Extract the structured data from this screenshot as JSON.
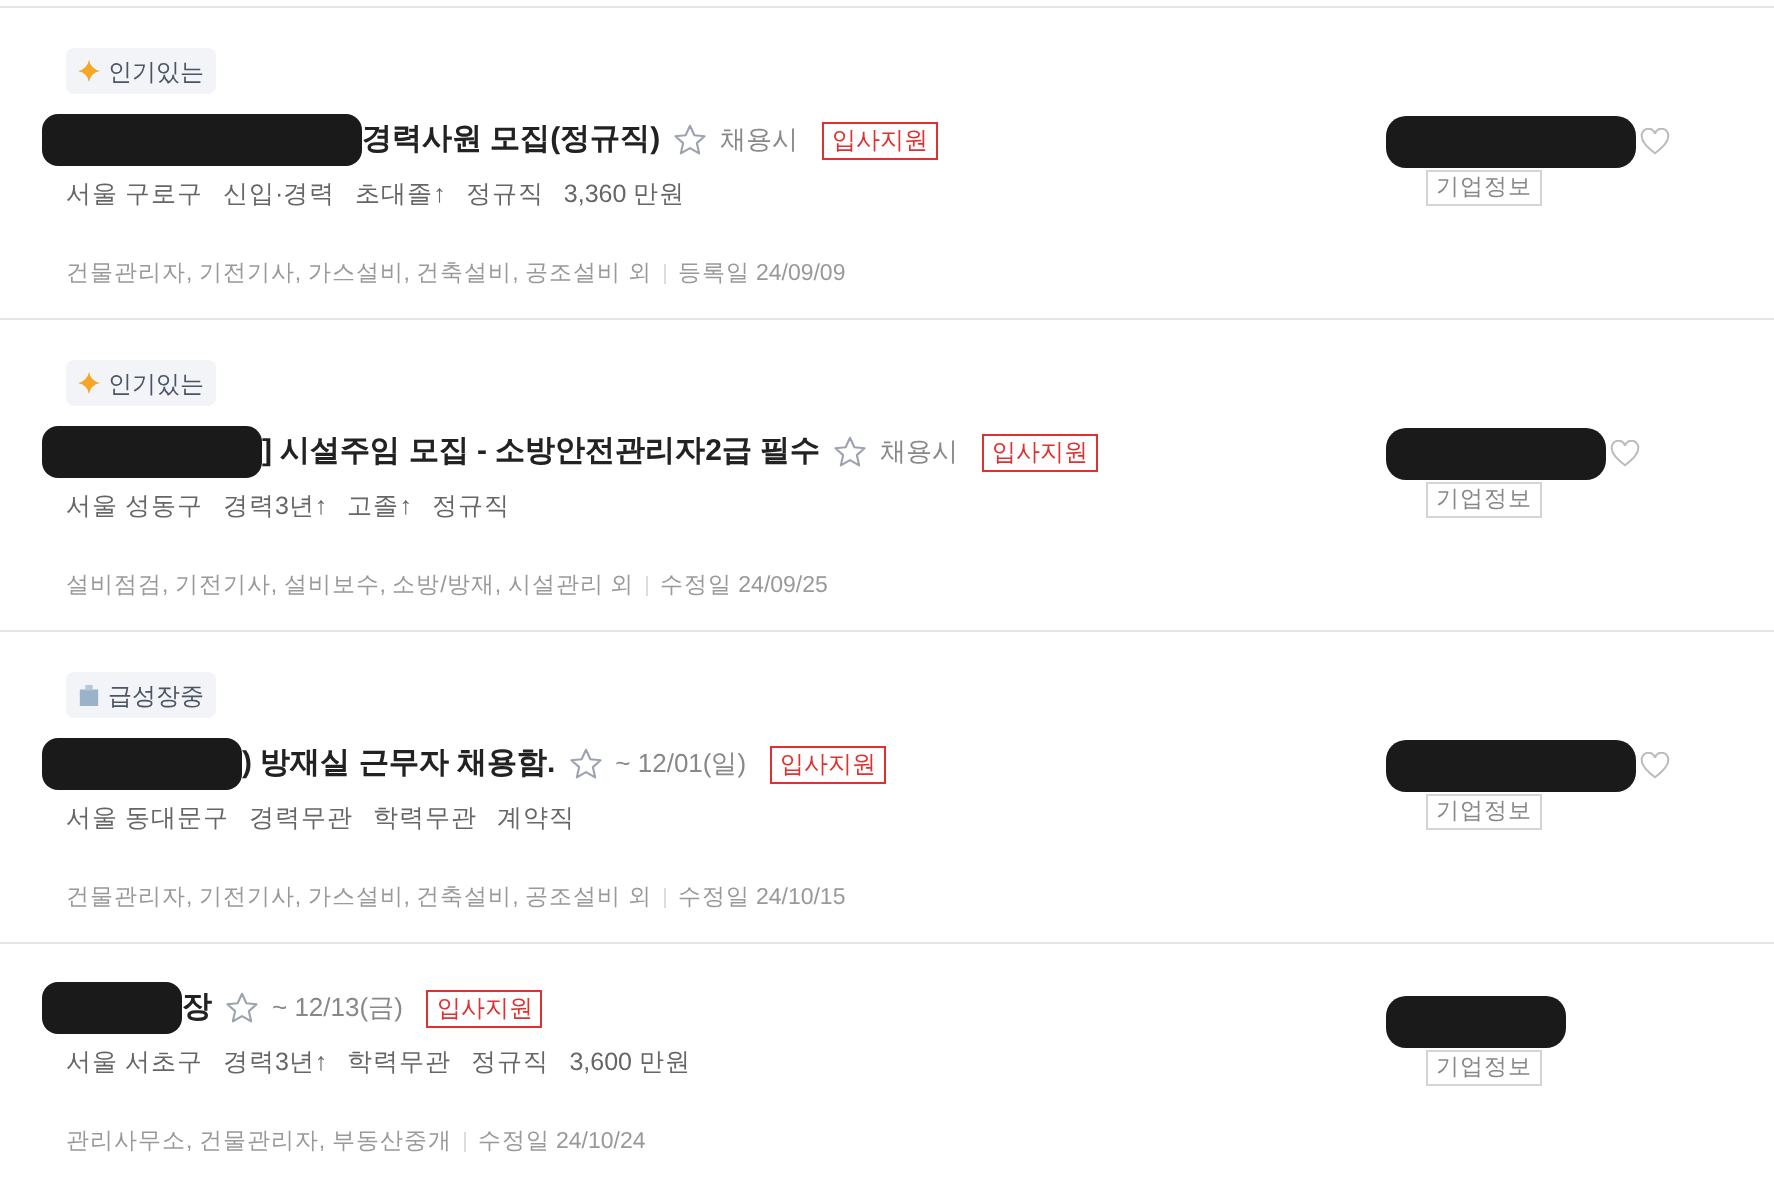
{
  "listings": [
    {
      "badge": {
        "kind": "popular",
        "label": "인기있는"
      },
      "title": "경력사원 모집(정규직)",
      "scrapped": false,
      "deadline": "채용시",
      "apply": "입사지원",
      "meta": [
        "서울 구로구",
        "신입·경력",
        "초대졸↑",
        "정규직",
        "3,360 만원"
      ],
      "jobs": "건물관리자, 기전기사, 가스설비, 건축설비, 공조설비 외",
      "date": "등록일 24/09/09",
      "favorite": false,
      "company_info": "기업정보"
    },
    {
      "badge": {
        "kind": "popular",
        "label": "인기있는"
      },
      "title": "] 시설주임 모집 - 소방안전관리자2급 필수",
      "scrapped": false,
      "deadline": "채용시",
      "apply": "입사지원",
      "meta": [
        "서울 성동구",
        "경력3년↑",
        "고졸↑",
        "정규직"
      ],
      "jobs": "설비점검, 기전기사, 설비보수, 소방/방재, 시설관리 외",
      "date": "수정일 24/09/25",
      "favorite": false,
      "company_info": "기업정보"
    },
    {
      "badge": {
        "kind": "growing",
        "label": "급성장중"
      },
      "title": ") 방재실 근무자 채용함.",
      "scrapped": false,
      "deadline": "~ 12/01(일)",
      "apply": "입사지원",
      "meta": [
        "서울 동대문구",
        "경력무관",
        "학력무관",
        "계약직"
      ],
      "jobs": "건물관리자, 기전기사, 가스설비, 건축설비, 공조설비 외",
      "date": "수정일 24/10/15",
      "favorite": false,
      "company_info": "기업정보"
    },
    {
      "title": "장",
      "scrapped": false,
      "deadline": "~ 12/13(금)",
      "apply": "입사지원",
      "meta": [
        "서울 서초구",
        "경력3년↑",
        "학력무관",
        "정규직",
        "3,600 만원"
      ],
      "jobs": "관리사무소, 건물관리자, 부동산중개",
      "date": "수정일 24/10/24",
      "company_info": "기업정보"
    }
  ]
}
